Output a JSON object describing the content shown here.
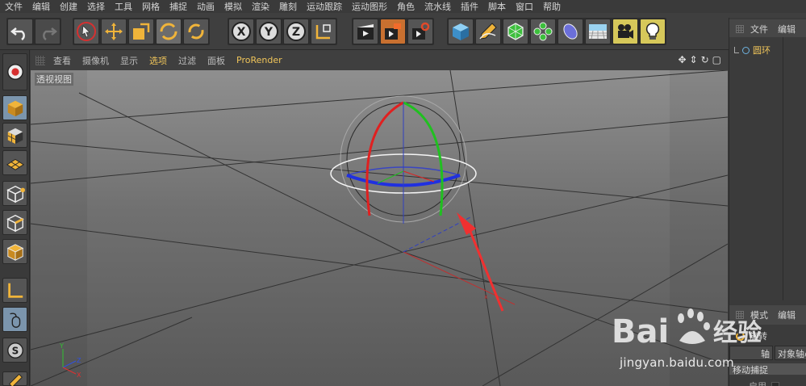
{
  "menubar": {
    "items": [
      "文件",
      "编辑",
      "创建",
      "选择",
      "工具",
      "网格",
      "捕捉",
      "动画",
      "模拟",
      "渲染",
      "雕刻",
      "运动跟踪",
      "运动图形",
      "角色",
      "流水线",
      "插件",
      "脚本",
      "窗口",
      "帮助"
    ]
  },
  "toolbar": {
    "icons": [
      "undo-icon",
      "redo-icon",
      "live-selection-icon",
      "move-icon",
      "scale-icon",
      "rotate-icon",
      "recent-tool-icon",
      "x-axis-icon",
      "y-axis-icon",
      "z-axis-icon",
      "coordinate-system-icon",
      "render-view-icon",
      "render-picture-viewer-icon",
      "edit-render-settings-icon",
      "cube-icon",
      "pen-icon",
      "subdivision-icon",
      "cloner-icon",
      "deformer-icon",
      "floor-icon",
      "camera-icon",
      "light-icon"
    ],
    "axis_labels": {
      "x": "X",
      "y": "Y",
      "z": "Z"
    }
  },
  "lefttools": {
    "icons": [
      "make-editable-icon",
      "model-mode-icon",
      "texture-mode-icon",
      "workplane-icon",
      "points-mode-icon",
      "edges-mode-icon",
      "polygons-mode-icon",
      "axis-mode-icon",
      "tweak-mode-icon",
      "snap-icon",
      "paint-icon"
    ]
  },
  "viewport": {
    "menu": [
      "查看",
      "摄像机",
      "显示",
      "选项",
      "过滤",
      "面板",
      "ProRender"
    ],
    "active_menu": "选项",
    "label": "透视视图",
    "nav_icons": [
      "move-view-icon",
      "zoom-view-icon",
      "rotate-view-icon",
      "toggle-view-icon"
    ],
    "axis_gizmo": {
      "y": "Y",
      "z": "Z",
      "x": "X"
    },
    "colors": {
      "x_axis": "#e03030",
      "y_axis": "#30c030",
      "z_axis": "#3040e0",
      "annotation_arrow": "#f03030"
    }
  },
  "objects_panel": {
    "tabs": [
      "文件",
      "编辑"
    ],
    "items": [
      {
        "name": "圆环"
      }
    ]
  },
  "attributes_panel": {
    "tabs": [
      "模式",
      "编辑"
    ],
    "tool_name": "旋转",
    "buttons": [
      "轴",
      "对象轴心"
    ],
    "section": "移动捕捉",
    "enable_label": "启用"
  },
  "watermark": {
    "brand": "Bai 经验",
    "url": "jingyan.baidu.com"
  }
}
